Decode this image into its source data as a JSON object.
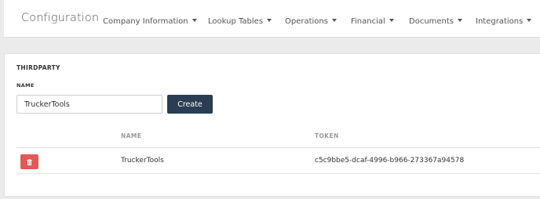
{
  "navbar": {
    "brand": "Configuration",
    "items": [
      {
        "label": "Company Information"
      },
      {
        "label": "Lookup Tables"
      },
      {
        "label": "Operations"
      },
      {
        "label": "Financial"
      },
      {
        "label": "Documents"
      },
      {
        "label": "Integrations"
      }
    ]
  },
  "panel": {
    "title": "THIRDPARTY",
    "name_label": "NAME",
    "name_value": "TruckerTools",
    "create_label": "Create"
  },
  "table": {
    "columns": [
      "NAME",
      "TOKEN"
    ],
    "rows": [
      {
        "name": "TruckerTools",
        "token": "c5c9bbe5-dcaf-4996-b966-273367a94578",
        "delete_icon": "trash-icon"
      }
    ]
  },
  "colors": {
    "create_button": "#2a3d52",
    "delete_button": "#e45858",
    "page_background": "#ebebeb"
  }
}
